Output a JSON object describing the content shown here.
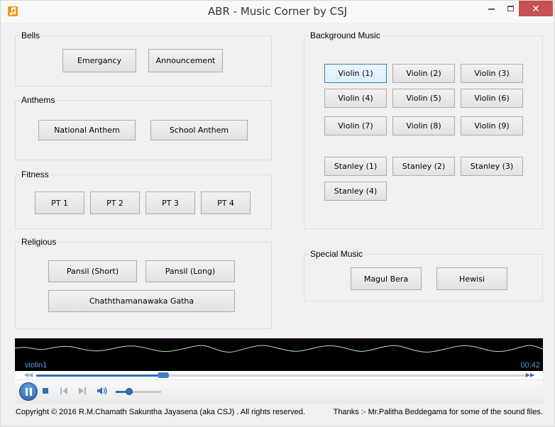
{
  "window": {
    "title": "ABR - Music Corner by CSJ",
    "close_glyph": "✕"
  },
  "bells": {
    "label": "Bells",
    "emergency": "Emergancy",
    "announcement": "Announcement"
  },
  "anthems": {
    "label": "Anthems",
    "national": "National Anthem",
    "school": "School Anthem"
  },
  "fitness": {
    "label": "Fitness",
    "pt1": "PT 1",
    "pt2": "PT 2",
    "pt3": "PT 3",
    "pt4": "PT 4"
  },
  "religious": {
    "label": "Religious",
    "pansil_short": "Pansil (Short)",
    "pansil_long": "Pansil (Long)",
    "gatha": "Chaththamanawaka Gatha"
  },
  "background_music": {
    "label": "Background Music",
    "violin": [
      "Violin (1)",
      "Violin (2)",
      "Violin (3)",
      "Violin (4)",
      "Violin (5)",
      "Violin (6)",
      "Violin (7)",
      "Violin (8)",
      "Violin (9)"
    ],
    "stanley": [
      "Stanley (1)",
      "Stanley (2)",
      "Stanley (3)",
      "Stanley (4)"
    ]
  },
  "special_music": {
    "label": "Special Music",
    "magul_bera": "Magul Bera",
    "hewisi": "Hewisi"
  },
  "player": {
    "track_name": "violin1",
    "time": "00:42",
    "seek_position": 0.26,
    "volume": 0.3,
    "state": "playing",
    "accent_color": "#2f6fb8"
  },
  "footer": {
    "copyright": "Copyright © 2016 R.M.Chamath Sakuntha Jayasena (aka CSJ) . All rights reserved.",
    "thanks": "Thanks :- Mr.Palitha Beddegama for some of the sound files."
  }
}
